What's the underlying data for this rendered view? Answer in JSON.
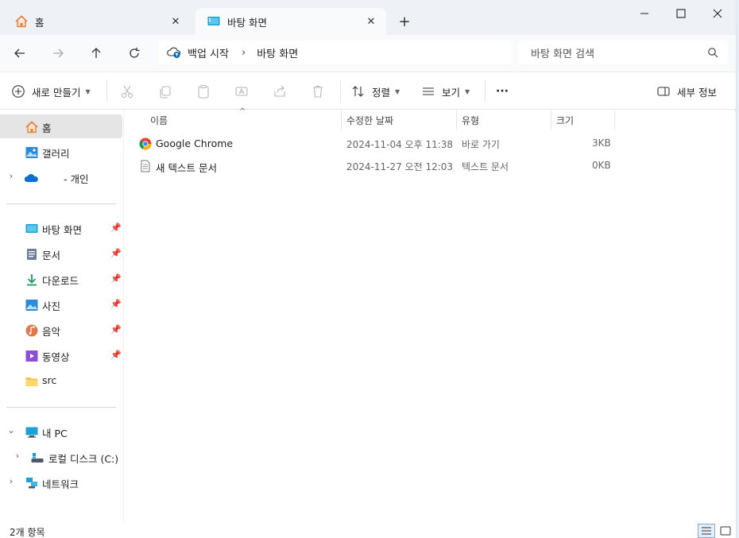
{
  "tabs": [
    {
      "label": "홈",
      "icon": "home-icon",
      "active": false
    },
    {
      "label": "바탕 화면",
      "icon": "desktop-icon",
      "active": true
    }
  ],
  "nav": {
    "backup_label": "백업 시작",
    "breadcrumb": "바탕 화면",
    "search_placeholder": "바탕 화면 검색"
  },
  "toolbar": {
    "new_label": "새로 만들기",
    "sort_label": "정렬",
    "view_label": "보기",
    "more_label": "···",
    "details_label": "세부 정보"
  },
  "sidebar": {
    "top": [
      {
        "label": "홈",
        "icon": "home-icon",
        "selected": true
      },
      {
        "label": "갤러리",
        "icon": "gallery-icon"
      },
      {
        "label": "- 개인",
        "icon": "onedrive-icon",
        "expandable": true
      }
    ],
    "pinned": [
      {
        "label": "바탕 화면",
        "icon": "desktop-icon"
      },
      {
        "label": "문서",
        "icon": "documents-icon"
      },
      {
        "label": "다운로드",
        "icon": "download-icon"
      },
      {
        "label": "사진",
        "icon": "pictures-icon"
      },
      {
        "label": "음악",
        "icon": "music-icon"
      },
      {
        "label": "동영상",
        "icon": "videos-icon"
      },
      {
        "label": "src",
        "icon": "folder-icon"
      }
    ],
    "devices": [
      {
        "label": "내 PC",
        "icon": "pc-icon"
      },
      {
        "label": "로컬 디스크 (C:)",
        "icon": "drive-icon"
      },
      {
        "label": "네트워크",
        "icon": "network-icon"
      }
    ]
  },
  "columns": {
    "name": "이름",
    "modified": "수정한 날짜",
    "type": "유형",
    "size": "크기"
  },
  "files": [
    {
      "name": "Google Chrome",
      "modified": "2024-11-04 오후 11:38",
      "type": "바로 가기",
      "size": "3KB",
      "icon": "chrome-icon"
    },
    {
      "name": "새 텍스트 문서",
      "modified": "2024-11-27 오전 12:03",
      "type": "텍스트 문서",
      "size": "0KB",
      "icon": "text-file-icon"
    }
  ],
  "status": {
    "count": "2개 항목"
  },
  "colors": {
    "accent": "#0067c0",
    "folder": "#f5c542",
    "home": "#e8833a"
  }
}
